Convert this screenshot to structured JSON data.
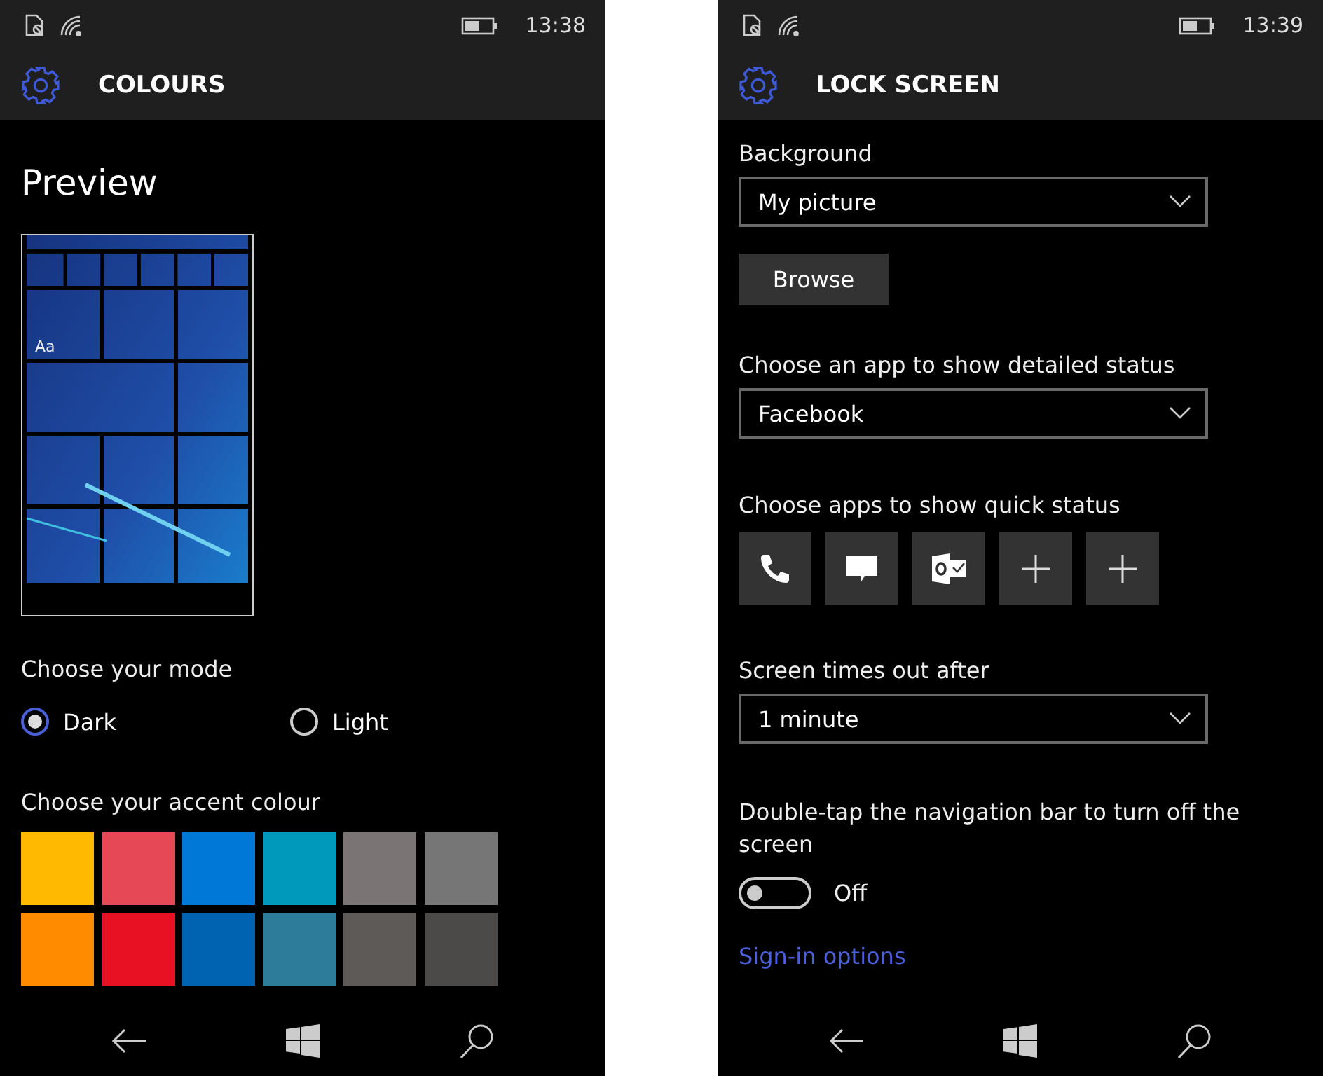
{
  "screens": [
    {
      "kind": "colours",
      "status_bar": {
        "time": "13:38"
      },
      "header": {
        "title": "COLOURS"
      },
      "preview": {
        "heading": "Preview",
        "sample_text": "Aa"
      },
      "mode": {
        "label": "Choose your mode",
        "options": [
          {
            "label": "Dark",
            "selected": true
          },
          {
            "label": "Light",
            "selected": false
          }
        ]
      },
      "accent": {
        "label": "Choose your accent colour",
        "swatches": [
          {
            "color": "#ffb900"
          },
          {
            "color": "#e74856"
          },
          {
            "color": "#0078d7"
          },
          {
            "color": "#0099bc"
          },
          {
            "color": "#7a7574"
          },
          {
            "color": "#767676"
          },
          {
            "color": "#ff8c00"
          },
          {
            "color": "#e81123"
          },
          {
            "color": "#0063b1"
          },
          {
            "color": "#2d7d9a"
          },
          {
            "color": "#5d5a58"
          },
          {
            "color": "#4c4a48"
          }
        ]
      }
    },
    {
      "kind": "lock_screen",
      "status_bar": {
        "time": "13:39"
      },
      "header": {
        "title": "LOCK SCREEN"
      },
      "background": {
        "label": "Background",
        "value": "My picture",
        "button": "Browse"
      },
      "detailed_status": {
        "label": "Choose an app to show detailed status",
        "value": "Facebook"
      },
      "quick_status": {
        "label": "Choose apps to show quick status",
        "apps": [
          {
            "kind": "phone"
          },
          {
            "kind": "message"
          },
          {
            "kind": "outlook"
          },
          {
            "kind": "add"
          },
          {
            "kind": "add"
          }
        ]
      },
      "timeout": {
        "label": "Screen times out after",
        "value": "1 minute"
      },
      "double_tap": {
        "label": "Double-tap the navigation bar to turn off the screen",
        "on": false,
        "state_text": "Off"
      },
      "link": "Sign-in options"
    }
  ]
}
